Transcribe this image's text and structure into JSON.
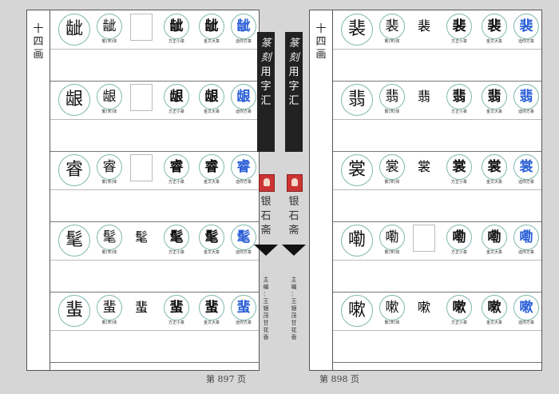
{
  "spine": {
    "title_chars": [
      "篆",
      "刻",
      "用",
      "字",
      "汇"
    ],
    "brand_chars": [
      "银",
      "石",
      "斋"
    ],
    "credit_chars": [
      "主",
      "编",
      "：",
      "王",
      "银",
      "茂",
      " ",
      "甘",
      "花",
      "香"
    ]
  },
  "captions": {
    "trad": "繁(宋)体",
    "fangzheng": "方正小篆",
    "jinwen": "金文大篆",
    "dixin": "迪你方篆"
  },
  "left": {
    "index_chars": [
      "十",
      "四",
      "画"
    ],
    "page_num": "第 897 页",
    "rows": [
      {
        "glyphs": [
          "龇",
          "龇",
          "",
          "龇",
          "龇",
          "龇"
        ]
      },
      {
        "glyphs": [
          "龈",
          "龈",
          "",
          "龈",
          "龈",
          "龈"
        ]
      },
      {
        "glyphs": [
          "睿",
          "睿",
          "",
          "睿",
          "睿",
          "睿"
        ]
      },
      {
        "glyphs": [
          "髦",
          "髦",
          "髦",
          "髦",
          "髦",
          "髦"
        ]
      },
      {
        "glyphs": [
          "蜚",
          "蜚",
          "蜚",
          "蜚",
          "蜚",
          "蜚"
        ]
      }
    ]
  },
  "right": {
    "index_chars": [
      "十",
      "四",
      "画"
    ],
    "page_num": "第 898 页",
    "rows": [
      {
        "glyphs": [
          "裴",
          "裴",
          "裴",
          "裴",
          "裴",
          "裴"
        ]
      },
      {
        "glyphs": [
          "翡",
          "翡",
          "翡",
          "翡",
          "翡",
          "翡"
        ]
      },
      {
        "glyphs": [
          "裳",
          "裳",
          "裳",
          "裳",
          "裳",
          "裳"
        ]
      },
      {
        "glyphs": [
          "嘞",
          "嘞",
          "",
          "嘞",
          "嘞",
          "嘞"
        ]
      },
      {
        "glyphs": [
          "嗽",
          "嗽",
          "嗽",
          "嗽",
          "嗽",
          "嗽"
        ]
      }
    ]
  },
  "colors": {
    "circle": "#7fb8b0",
    "blue_glyph": "#2b5fd6",
    "spine_bg": "#222222"
  }
}
